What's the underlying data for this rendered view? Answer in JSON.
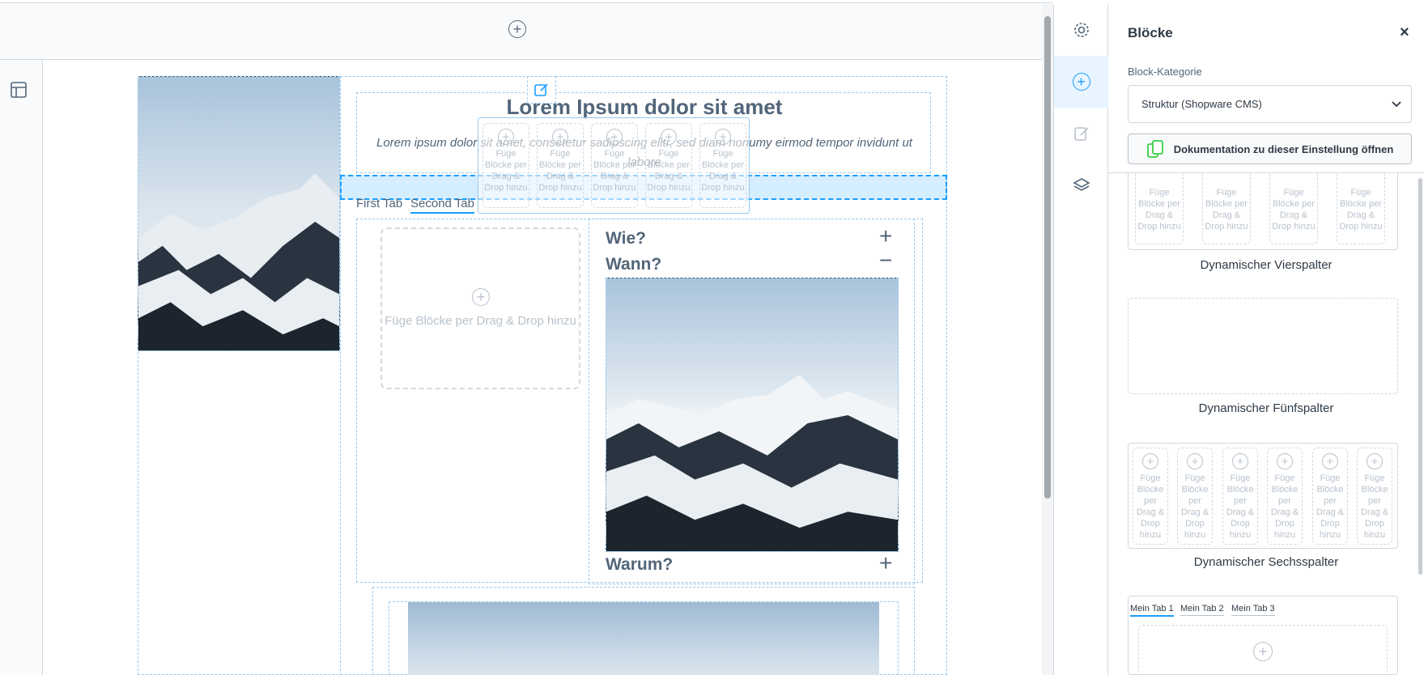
{
  "canvas": {
    "hero_title": "Lorem Ipsum dolor sit amet",
    "hero_text": "Lorem ipsum dolor sit amet, consetetur sadipscing elitr, sed diam nonumy eirmod tempor invidunt ut labore",
    "tabs": [
      {
        "label": "First Tab"
      },
      {
        "label": "Second Tab"
      }
    ],
    "drop_placeholder": "Füge Blöcke per Drag & Drop hinzu",
    "column_placeholder": "Füge Blöcke per Drag & Drop hinzu",
    "accordion": [
      {
        "label": "Wie?",
        "state": "+"
      },
      {
        "label": "Wann?",
        "state": "−"
      },
      {
        "label": "Warum?",
        "state": "+"
      }
    ]
  },
  "sidebar": {
    "title": "Blöcke",
    "close_icon": "×",
    "category_label": "Block-Kategorie",
    "category_value": "Struktur (Shopware CMS)",
    "doc_button": "Dokumentation zu dieser Einstellung öffnen",
    "col_placeholder": "Füge Blöcke per Drag & Drop hinzu",
    "blocks": [
      {
        "label": "Dynamischer Vierspalter"
      },
      {
        "label": "Dynamischer Fünfspalter"
      },
      {
        "label": "Dynamischer Sechsspalter"
      }
    ],
    "tab_block": {
      "tabs": [
        {
          "label": "Mein Tab 1"
        },
        {
          "label": "Mein Tab 2"
        },
        {
          "label": "Mein Tab 3"
        }
      ]
    }
  },
  "colors": {
    "accent": "#189eff",
    "text": "#52667a",
    "dashed": "#9ac9ec",
    "doc_icon": "#37d046"
  },
  "icons": {
    "add_section": "plus-circle-icon",
    "layout": "layout-icon",
    "settings": "gear-icon",
    "blocks": "plus-circle-icon",
    "edit": "edit-icon",
    "layers": "layers-icon"
  }
}
